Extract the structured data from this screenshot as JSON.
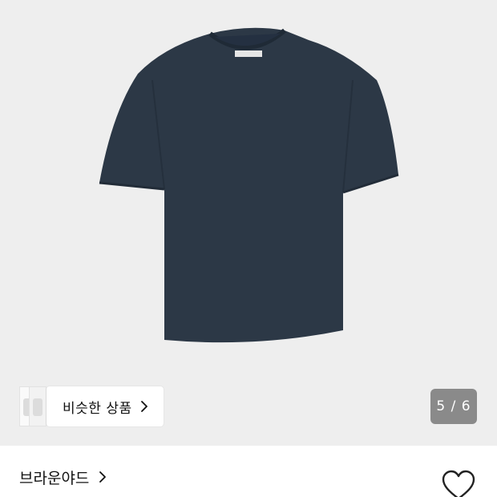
{
  "gallery": {
    "product_image_alt": "navy short-sleeve t-shirt",
    "background_color": "#eeeeee",
    "garment_color": "#2c3846",
    "page_counter": "5 / 6",
    "similar_products_label": "비슷한 상품"
  },
  "brand": {
    "name": "브라운야드"
  },
  "icons": {
    "similar_chevron": "chevron-right-icon",
    "brand_chevron": "chevron-right-icon",
    "like": "heart-outline-icon"
  }
}
